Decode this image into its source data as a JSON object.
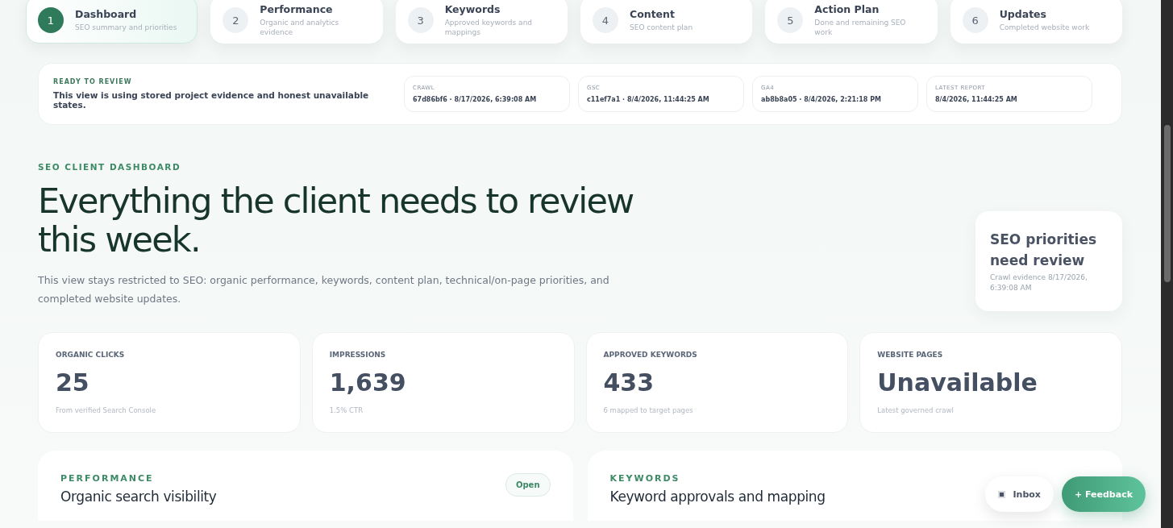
{
  "steps": [
    {
      "number": "1",
      "title": "Dashboard",
      "subtitle": "SEO summary and priorities",
      "selected": true
    },
    {
      "number": "2",
      "title": "Performance",
      "subtitle": "Organic and analytics evidence",
      "selected": false
    },
    {
      "number": "3",
      "title": "Keywords",
      "subtitle": "Approved keywords and mappings",
      "selected": false
    },
    {
      "number": "4",
      "title": "Content",
      "subtitle": "SEO content plan",
      "selected": false
    },
    {
      "number": "5",
      "title": "Action Plan",
      "subtitle": "Done and remaining SEO work",
      "selected": false
    },
    {
      "number": "6",
      "title": "Updates",
      "subtitle": "Completed website work",
      "selected": false
    }
  ],
  "status": {
    "label": "READY TO REVIEW",
    "message": "This view is using stored project evidence and honest unavailable states.",
    "sources": [
      {
        "label": "CRAWL",
        "value": "67d86bf6 · 8/17/2026, 6:39:08 AM"
      },
      {
        "label": "GSC",
        "value": "c11ef7a1 · 8/4/2026, 11:44:25 AM"
      },
      {
        "label": "GA4",
        "value": "ab8b8a05 · 8/4/2026, 2:21:18 PM"
      },
      {
        "label": "LATEST REPORT",
        "value": "8/4/2026, 11:44:25 AM"
      }
    ]
  },
  "hero": {
    "eyebrow": "SEO CLIENT DASHBOARD",
    "heading": "Everything the client needs to review this week.",
    "description": "This view stays restricted to SEO: organic performance, keywords, content plan, technical/on-page priorities, and completed website updates.",
    "priority": {
      "title": "SEO priorities need review",
      "detail": "Crawl evidence 8/17/2026, 6:39:08 AM"
    }
  },
  "metrics": [
    {
      "label": "ORGANIC CLICKS",
      "value": "25",
      "note": "From verified Search Console"
    },
    {
      "label": "IMPRESSIONS",
      "value": "1,639",
      "note": "1.5% CTR"
    },
    {
      "label": "APPROVED KEYWORDS",
      "value": "433",
      "note": "6 mapped to target pages"
    },
    {
      "label": "WEBSITE PAGES",
      "value": "Unavailable",
      "note": "Latest governed crawl"
    }
  ],
  "panels": [
    {
      "eyebrow": "PERFORMANCE",
      "title": "Organic search visibility",
      "action": "Open"
    },
    {
      "eyebrow": "KEYWORDS",
      "title": "Keyword approvals and mapping"
    }
  ],
  "floating": {
    "inbox": "Inbox",
    "feedback_icon": "+",
    "feedback": "Feedback"
  }
}
